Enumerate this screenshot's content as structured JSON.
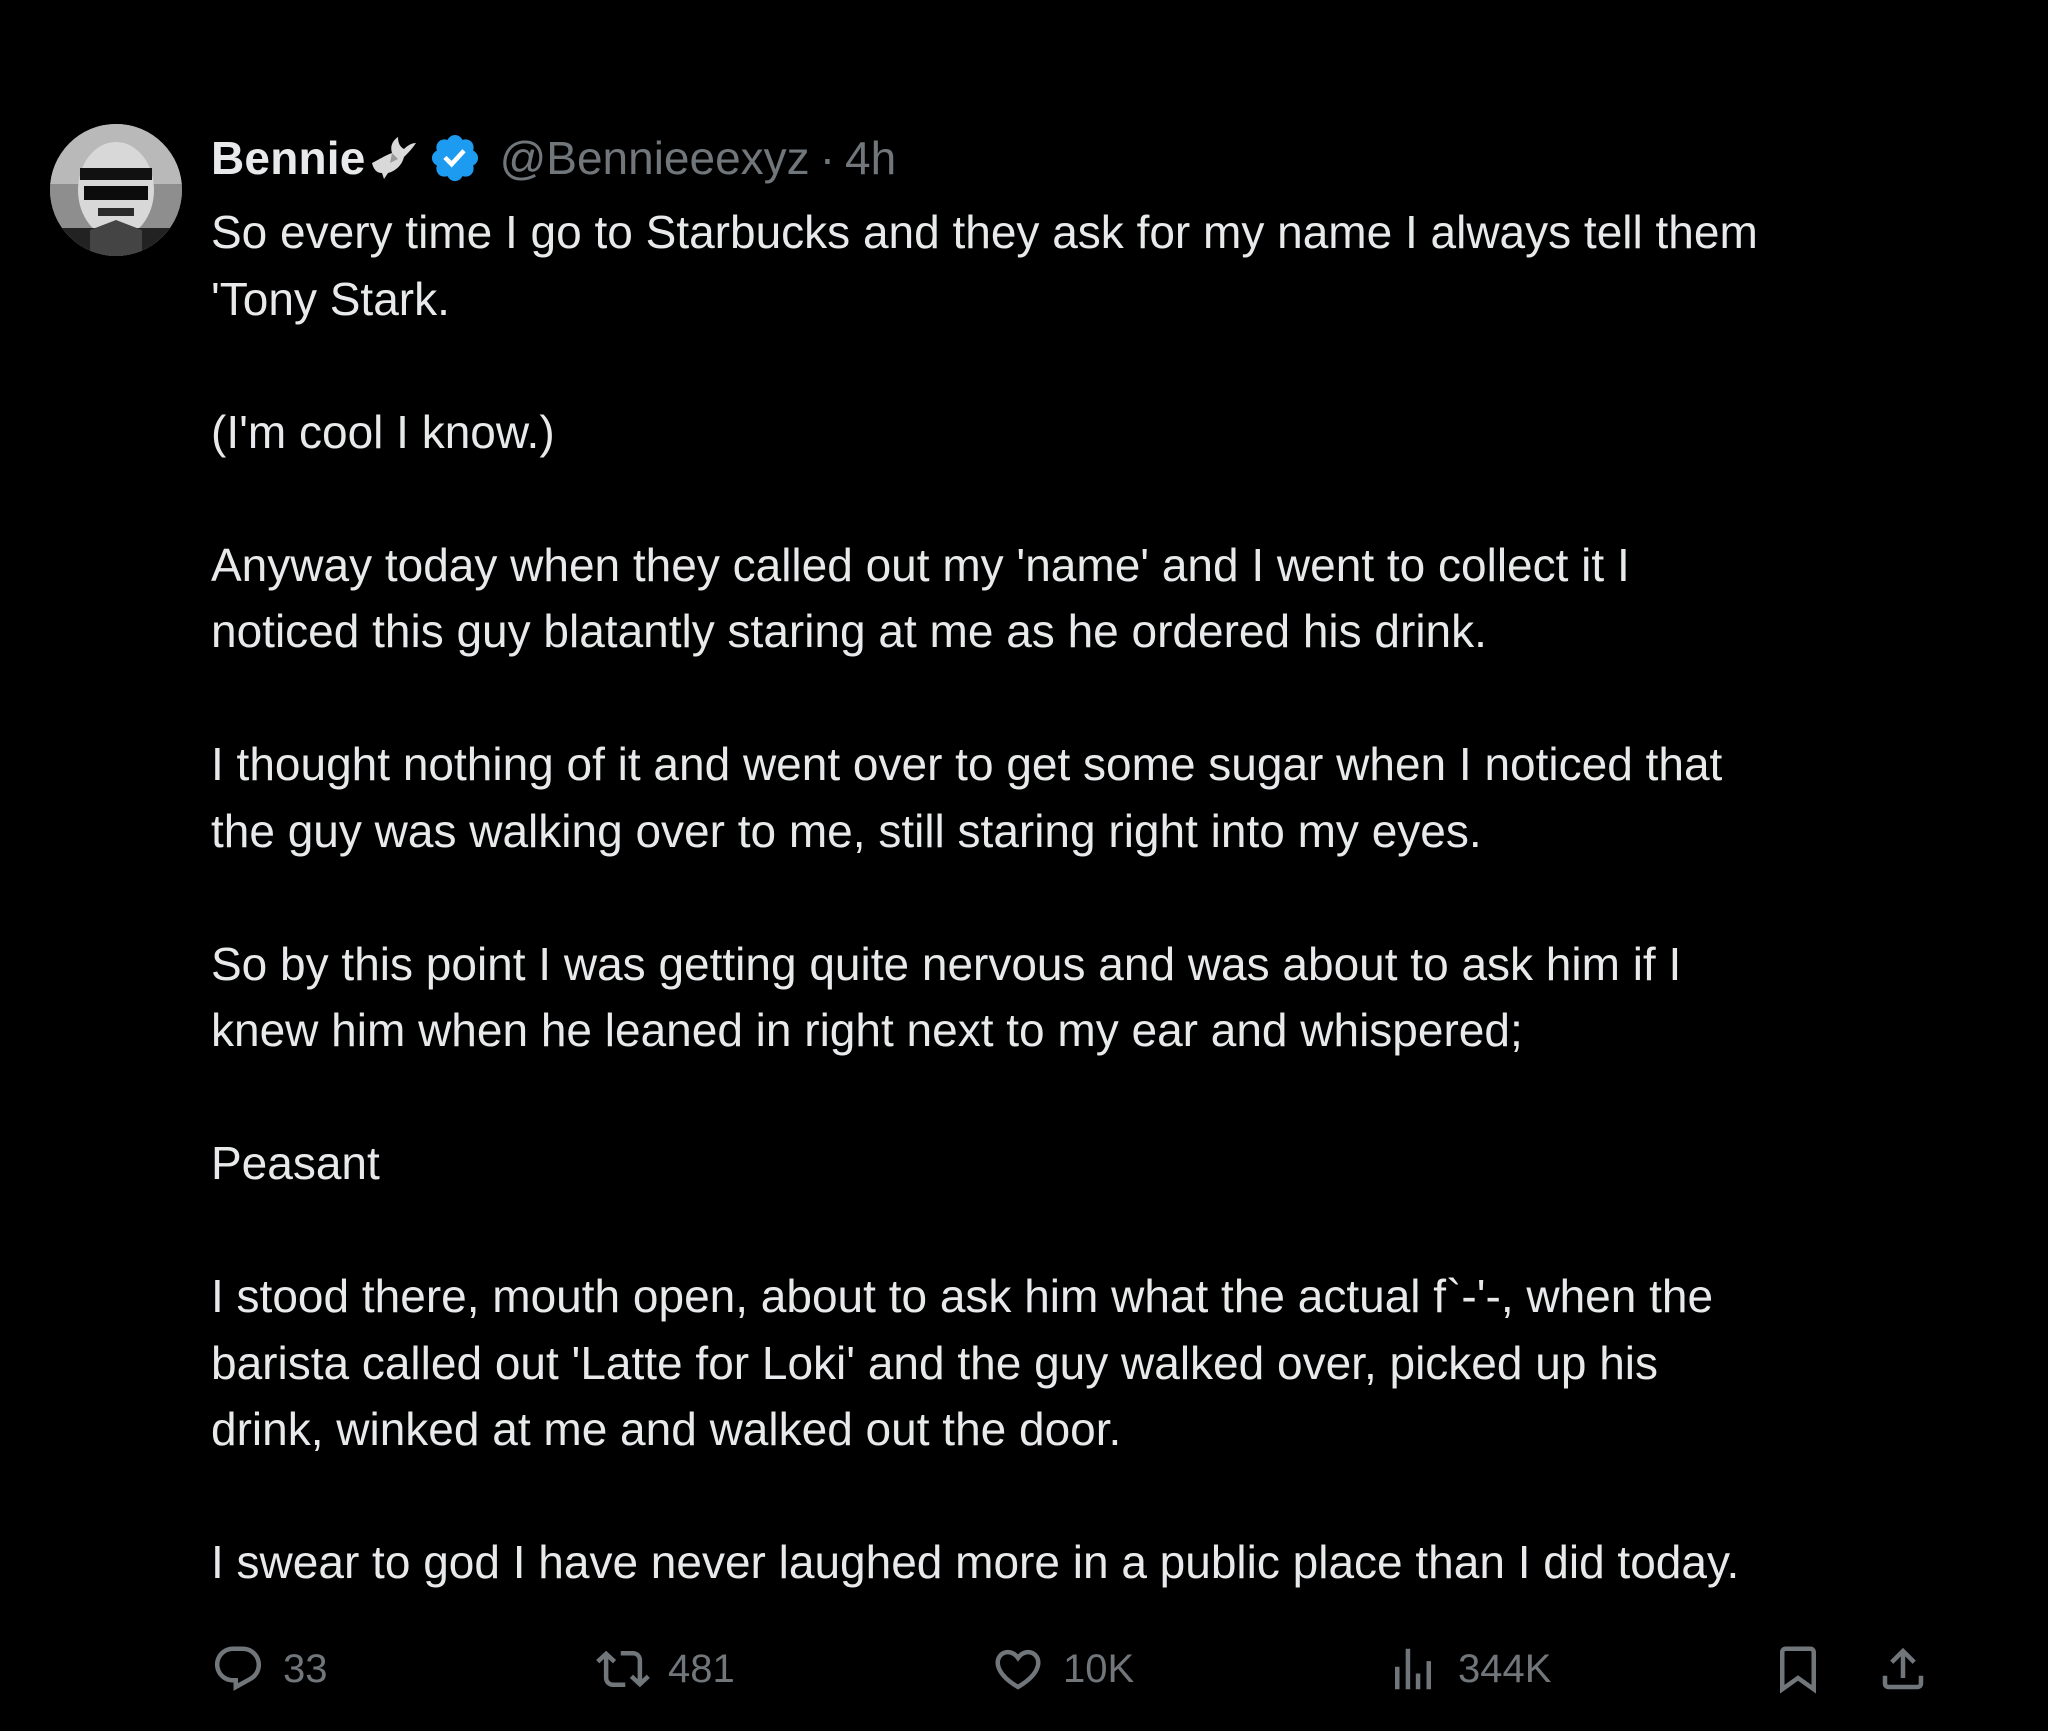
{
  "tweet": {
    "author": {
      "display_name": "Bennie",
      "handle": "@Bennieeexyz",
      "separator": "·",
      "time": "4h",
      "verified": true,
      "badge_color": "#1d9bf0"
    },
    "paragraphs": [
      "So every time I go to Starbucks and they ask for my name I always tell them\n'Tony Stark.",
      "(I'm cool I know.)",
      "Anyway today when they called out my 'name' and I went to collect it I\nnoticed this guy blatantly staring at me as he ordered his drink.",
      "I thought nothing of it and went over to get some sugar when I noticed that\nthe guy was walking over to me, still staring right into my eyes.",
      "So by this point I was getting quite nervous and was about to ask him if I\nknew him when he leaned in right next to my ear and whispered;",
      "Peasant",
      "I stood there, mouth open, about to ask him what the actual f`-'-, when the\nbarista called out 'Latte for Loki' and the guy walked over, picked up his\ndrink, winked at me and walked out the door.",
      "I swear to god I have never laughed more in a public place than I did today."
    ],
    "metrics": {
      "replies": "33",
      "reposts": "481",
      "likes": "10K",
      "views": "344K"
    }
  },
  "icons": {
    "reply": "reply-icon",
    "repost": "repost-icon",
    "like": "heart-icon",
    "views": "views-icon",
    "bookmark": "bookmark-icon",
    "share": "share-icon",
    "verified": "verified-badge-icon",
    "dove": "dove-icon"
  },
  "colors": {
    "background": "#000000",
    "text": "#e7e9ea",
    "secondary": "#71767b",
    "verified": "#1d9bf0"
  }
}
